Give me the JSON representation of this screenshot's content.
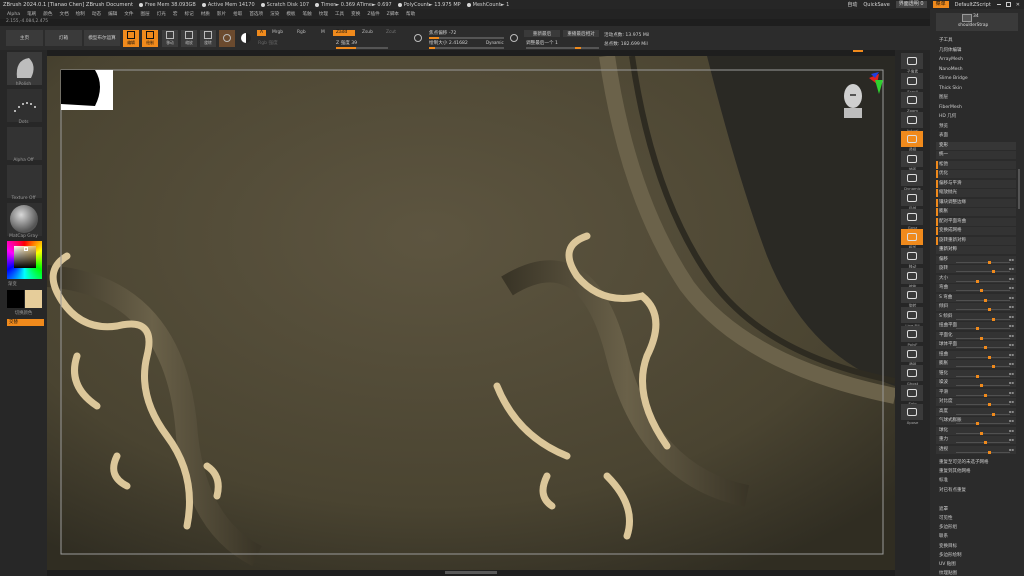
{
  "titlebar": {
    "title": "ZBrush 2024.0.1 [Tianao Chen]   ZBrush Document",
    "free_mem": "Free Mem 38.093GB",
    "active_mem": "Active Mem 14170",
    "scratch": "Scratch Disk 107",
    "timer": "Timer► 0.369 ATime► 0.697",
    "polycount": "PolyCount► 13.975 MP",
    "meshcount": "MeshCount► 1",
    "autosave": "自动",
    "quicksave": "QuickSave",
    "transparency": "界面透明 0",
    "menus": "菜单",
    "script": "DefaultZScript"
  },
  "menubar": [
    "Alpha",
    "笔刷",
    "颜色",
    "文档",
    "绘制",
    "动态",
    "编辑",
    "文件",
    "图层",
    "灯光",
    "宏",
    "标记",
    "材质",
    "影片",
    "拾取",
    "首选项",
    "渲染",
    "模板",
    "笔触",
    "纹理",
    "工具",
    "变换",
    "Z插件",
    "Z脚本",
    "帮助"
  ],
  "coords": "2.155,-4.084,2.475",
  "shelf": {
    "home": "主页",
    "lightbox": "灯箱",
    "live_boolean": "模型布尔运算",
    "tools": [
      "编辑",
      "绘制",
      "移动",
      "缩放",
      "旋转"
    ],
    "a": "A",
    "mrgb": "Mrgb",
    "rgb": "Rgb",
    "m": "M",
    "zadd": "Zadd",
    "zsub": "Zsub",
    "zcut": "Zcut",
    "rgb_intensity": "Rgb 强度",
    "z_intensity": "Z 强度 39",
    "focal_shift": "焦点偏移 -72",
    "draw_size": "绘制大小 2.41682",
    "dynamic": "Dynamic",
    "active_points": "活动点数: 13.975 Mil",
    "total_points": "总点数: 182.699 Mil",
    "sym_high": "重新最后",
    "sym_low": "调整最后一个 1",
    "replay_last_rel": "重播最后相对"
  },
  "leftshelf": {
    "brush": "hPolish",
    "stroke": "Dots",
    "alpha": "Alpha Off",
    "texture": "Texture Off",
    "material": "MatCap Gray",
    "gradient": "渐变",
    "switch_color": "切换颜色",
    "alternate": "交替"
  },
  "rightcol": [
    {
      "label": "子像素"
    },
    {
      "label": "Scroll"
    },
    {
      "label": "Zoom"
    },
    {
      "label": "Actual"
    },
    {
      "label": "透视"
    },
    {
      "label": "地面"
    },
    {
      "label": "Dynamic"
    },
    {
      "label": "局部"
    },
    {
      "label": "Gxyz"
    },
    {
      "label": "框架"
    },
    {
      "label": "移动"
    },
    {
      "label": "缩放"
    },
    {
      "label": "旋转"
    },
    {
      "label": "Line Fill"
    },
    {
      "label": "PolyF"
    },
    {
      "label": "透明"
    },
    {
      "label": "Ghost"
    },
    {
      "label": "Solo"
    },
    {
      "label": "Xpose"
    }
  ],
  "panel": {
    "subtool_count": "34",
    "subtool_name": "shoulderStrap",
    "rows": [
      "子工具",
      "几何体编辑",
      "ArrayMesh",
      "NanoMesh",
      "Slime Bridge",
      "Thick Skin",
      "图层",
      "FiberMesh",
      "HD 几何",
      "预览",
      "表面",
      "变形",
      "统一",
      "松弛",
      "优化",
      "偏移与平滑",
      "缩放抛光",
      "镶块调整边缘",
      "膨胀",
      "配对平面弯曲",
      "变换成网格",
      "旋转重新对称",
      "重新对称",
      "偏移",
      "旋转",
      "大小",
      "弯曲",
      "S 弯曲",
      "倾斜",
      "S 倾斜",
      "扭曲平面",
      "平面化",
      "球体平面",
      "扭曲",
      "膨胀",
      "锥化",
      "噪波",
      "平滑",
      "对比度",
      "高度",
      "气球式膨胀",
      "球化",
      "重力",
      "透视",
      "重复至可见的未选子网格",
      "重复到其他网格",
      "标准",
      "对已有点重复",
      "遮罩",
      "可见性",
      "多边形组",
      "联系",
      "变换目标",
      "多边形绘制",
      "UV 贴图",
      "纹理贴图"
    ]
  }
}
